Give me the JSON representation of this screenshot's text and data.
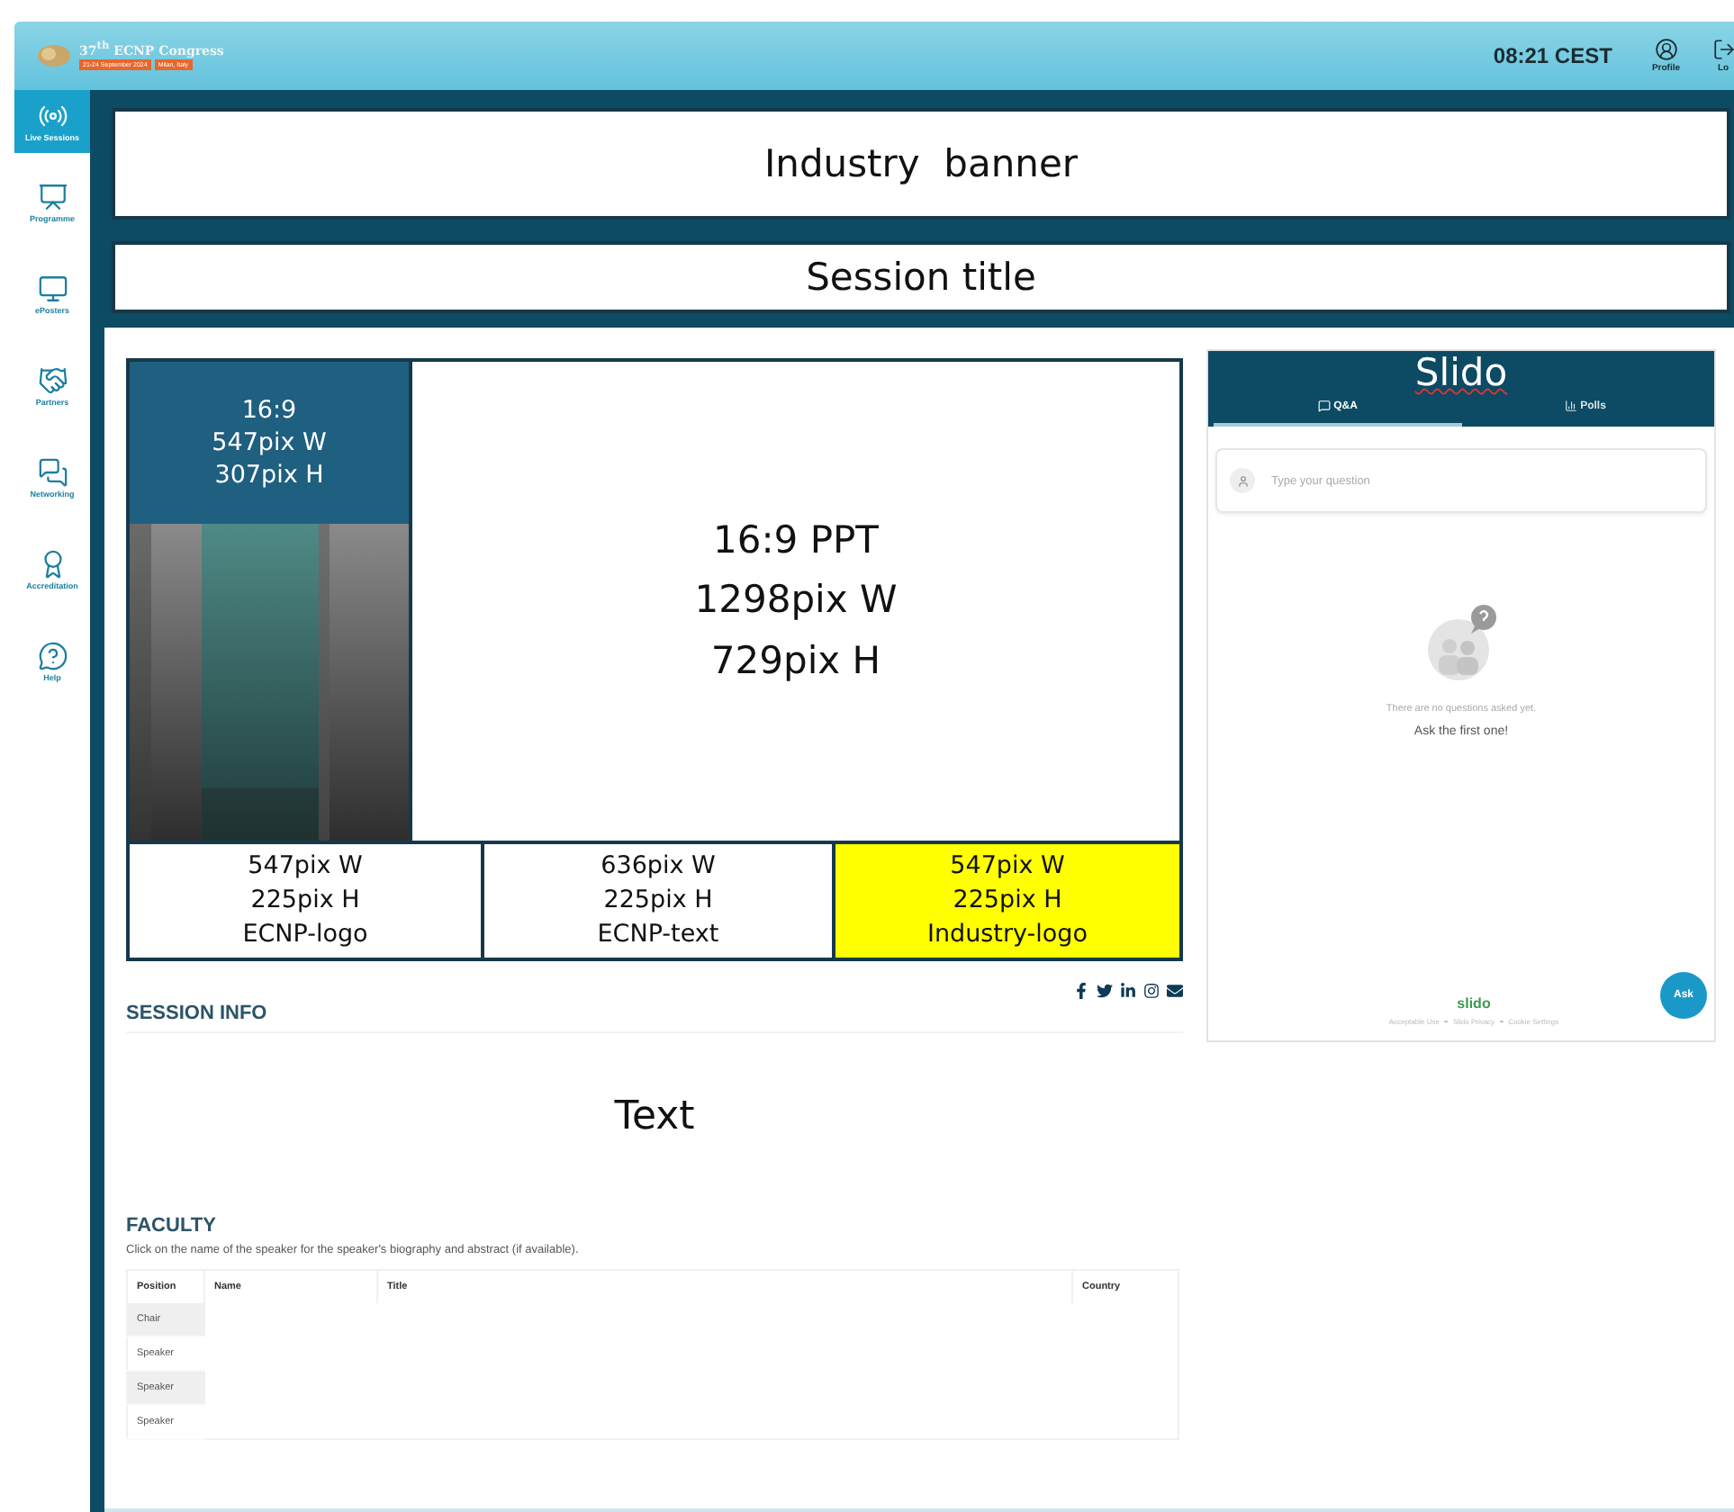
{
  "header": {
    "logo": {
      "title": "37$^{th}$ ECNP Congress",
      "dates": "21-24 September 2024",
      "place": "Milan, Italy"
    },
    "time": "08:21 CEST",
    "actions": [
      {
        "label": "Profile",
        "kind": "profile"
      },
      {
        "label": "Lo",
        "kind": "logout"
      }
    ]
  },
  "sidebar": {
    "items": [
      {
        "label": "Live Sessions",
        "kind": "broadcast",
        "selected": true
      },
      {
        "label": "Programme",
        "kind": "programme",
        "selected": false
      },
      {
        "label": "ePosters",
        "kind": "posters",
        "selected": false
      },
      {
        "label": "Partners",
        "kind": "partners",
        "selected": false
      },
      {
        "label": "Networking",
        "kind": "networking",
        "selected": false
      },
      {
        "label": "Accreditation",
        "kind": "accreditation",
        "selected": false
      },
      {
        "label": "Help",
        "kind": "help",
        "selected": false
      }
    ]
  },
  "banners": [
    "Industry  banner",
    "Session title"
  ],
  "player": {
    "camera": {
      "lines": [
        "16:9",
        "547pix W",
        "307pix H"
      ]
    },
    "slides": {
      "lines": [
        "16:9 PPT",
        "1298pix W",
        "729pix H"
      ]
    },
    "slots": [
      {
        "lines": [
          "547pix W",
          "225pix H",
          "ECNP-logo"
        ],
        "highlighted": false
      },
      {
        "lines": [
          "636pix W",
          "225pix H",
          "ECNP-text"
        ],
        "highlighted": false
      },
      {
        "lines": [
          "547pix W",
          "225pix H",
          "Industry-logo"
        ],
        "highlighted": true
      }
    ]
  },
  "slido": {
    "title": "Slido",
    "tabs": [
      {
        "label": "Q&A",
        "kind": "qa",
        "selected": true
      },
      {
        "label": "Polls",
        "kind": "polls",
        "selected": false
      }
    ],
    "question": {
      "placeholder": "Type your question"
    },
    "empty": {
      "message": "There are no questions asked yet.",
      "prompt": "Ask the first one!"
    },
    "brand": "slido",
    "links": [
      "Acceptable Use",
      "Slido Privacy",
      "Cookie Settings"
    ],
    "ask_button": "Ask"
  },
  "session_info": {
    "heading": "SESSION INFO",
    "body": "Text"
  },
  "faculty": {
    "heading": "FACULTY",
    "note": "Click on the name of the speaker for the speaker's biography and abstract (if available).",
    "table": {
      "columns": [
        "Position",
        "Name",
        "Title",
        "Country"
      ],
      "rows": [
        {
          "position": "Chair"
        },
        {
          "position": "Speaker"
        },
        {
          "position": "Speaker"
        },
        {
          "position": "Speaker"
        }
      ]
    }
  }
}
